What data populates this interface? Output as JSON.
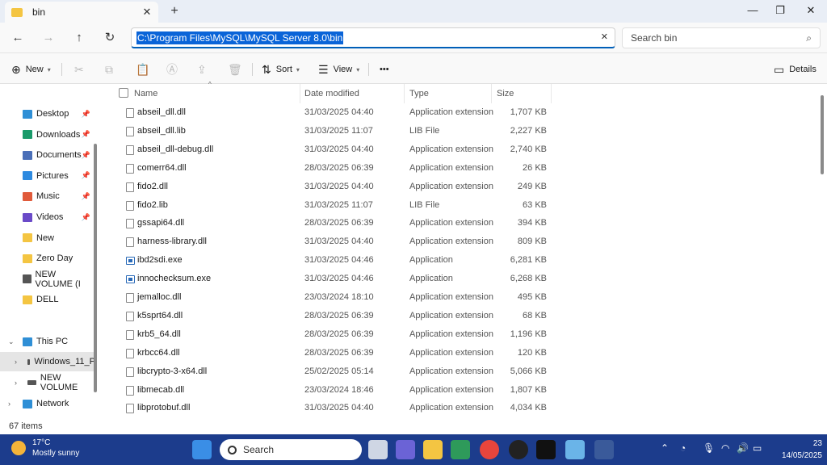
{
  "window": {
    "tab_title": "bin",
    "tab_close": "✕",
    "new_tab": "+",
    "minimize": "—",
    "maximize": "❐",
    "close": "✕"
  },
  "address_bar": {
    "path": "C:\\Program Files\\MySQL\\MySQL Server 8.0\\bin",
    "search_placeholder": "Search bin"
  },
  "command_bar": {
    "new_label": "New",
    "sort_label": "Sort",
    "view_label": "View",
    "more_label": "•••",
    "details_label": "Details"
  },
  "sidebar": {
    "items": [
      {
        "label": "Desktop",
        "icon": "desktop-icon",
        "color": "#2f8fd6",
        "pinned": true
      },
      {
        "label": "Downloads",
        "icon": "downloads-icon",
        "color": "#1a9a6a",
        "pinned": true
      },
      {
        "label": "Documents",
        "icon": "documents-icon",
        "color": "#4a6fb8",
        "pinned": true
      },
      {
        "label": "Pictures",
        "icon": "pictures-icon",
        "color": "#2d8ae0",
        "pinned": true
      },
      {
        "label": "Music",
        "icon": "music-icon",
        "color": "#e05a3a",
        "pinned": true
      },
      {
        "label": "Videos",
        "icon": "videos-icon",
        "color": "#6a4ac8",
        "pinned": true
      },
      {
        "label": "New",
        "icon": "folder-icon",
        "color": "#f4c542",
        "pinned": false
      },
      {
        "label": "Zero Day",
        "icon": "folder-icon",
        "color": "#f4c542",
        "pinned": false
      },
      {
        "label": "NEW VOLUME (I",
        "icon": "drive-icon",
        "color": "#555555",
        "pinned": false
      },
      {
        "label": "DELL",
        "icon": "folder-icon",
        "color": "#f4c542",
        "pinned": false
      }
    ],
    "this_pc": "This PC",
    "windows_drive": "Windows_11_P",
    "new_volume": "NEW VOLUME",
    "network": "Network"
  },
  "columns": {
    "name": "Name",
    "date": "Date modified",
    "type": "Type",
    "size": "Size"
  },
  "files": [
    {
      "name": "abseil_dll.dll",
      "date": "31/03/2025 04:40",
      "type": "Application extension",
      "size": "1,707 KB",
      "kind": "dll"
    },
    {
      "name": "abseil_dll.lib",
      "date": "31/03/2025 11:07",
      "type": "LIB File",
      "size": "2,227 KB",
      "kind": "lib"
    },
    {
      "name": "abseil_dll-debug.dll",
      "date": "31/03/2025 04:40",
      "type": "Application extension",
      "size": "2,740 KB",
      "kind": "dll"
    },
    {
      "name": "comerr64.dll",
      "date": "28/03/2025 06:39",
      "type": "Application extension",
      "size": "26 KB",
      "kind": "dll"
    },
    {
      "name": "fido2.dll",
      "date": "31/03/2025 04:40",
      "type": "Application extension",
      "size": "249 KB",
      "kind": "dll"
    },
    {
      "name": "fido2.lib",
      "date": "31/03/2025 11:07",
      "type": "LIB File",
      "size": "63 KB",
      "kind": "lib"
    },
    {
      "name": "gssapi64.dll",
      "date": "28/03/2025 06:39",
      "type": "Application extension",
      "size": "394 KB",
      "kind": "dll"
    },
    {
      "name": "harness-library.dll",
      "date": "31/03/2025 04:40",
      "type": "Application extension",
      "size": "809 KB",
      "kind": "dll"
    },
    {
      "name": "ibd2sdi.exe",
      "date": "31/03/2025 04:46",
      "type": "Application",
      "size": "6,281 KB",
      "kind": "exe"
    },
    {
      "name": "innochecksum.exe",
      "date": "31/03/2025 04:46",
      "type": "Application",
      "size": "6,268 KB",
      "kind": "exe"
    },
    {
      "name": "jemalloc.dll",
      "date": "23/03/2024 18:10",
      "type": "Application extension",
      "size": "495 KB",
      "kind": "dll"
    },
    {
      "name": "k5sprt64.dll",
      "date": "28/03/2025 06:39",
      "type": "Application extension",
      "size": "68 KB",
      "kind": "dll"
    },
    {
      "name": "krb5_64.dll",
      "date": "28/03/2025 06:39",
      "type": "Application extension",
      "size": "1,196 KB",
      "kind": "dll"
    },
    {
      "name": "krbcc64.dll",
      "date": "28/03/2025 06:39",
      "type": "Application extension",
      "size": "120 KB",
      "kind": "dll"
    },
    {
      "name": "libcrypto-3-x64.dll",
      "date": "25/02/2025 05:14",
      "type": "Application extension",
      "size": "5,066 KB",
      "kind": "dll"
    },
    {
      "name": "libmecab.dll",
      "date": "23/03/2024 18:46",
      "type": "Application extension",
      "size": "1,807 KB",
      "kind": "dll"
    },
    {
      "name": "libprotobuf.dll",
      "date": "31/03/2025 04:40",
      "type": "Application extension",
      "size": "4,034 KB",
      "kind": "dll"
    }
  ],
  "status": {
    "item_count": "67 items"
  },
  "taskbar": {
    "temperature": "17°C",
    "weather": "Mostly sunny",
    "search_label": "Search",
    "date": "14/05/2025",
    "time": "23"
  }
}
